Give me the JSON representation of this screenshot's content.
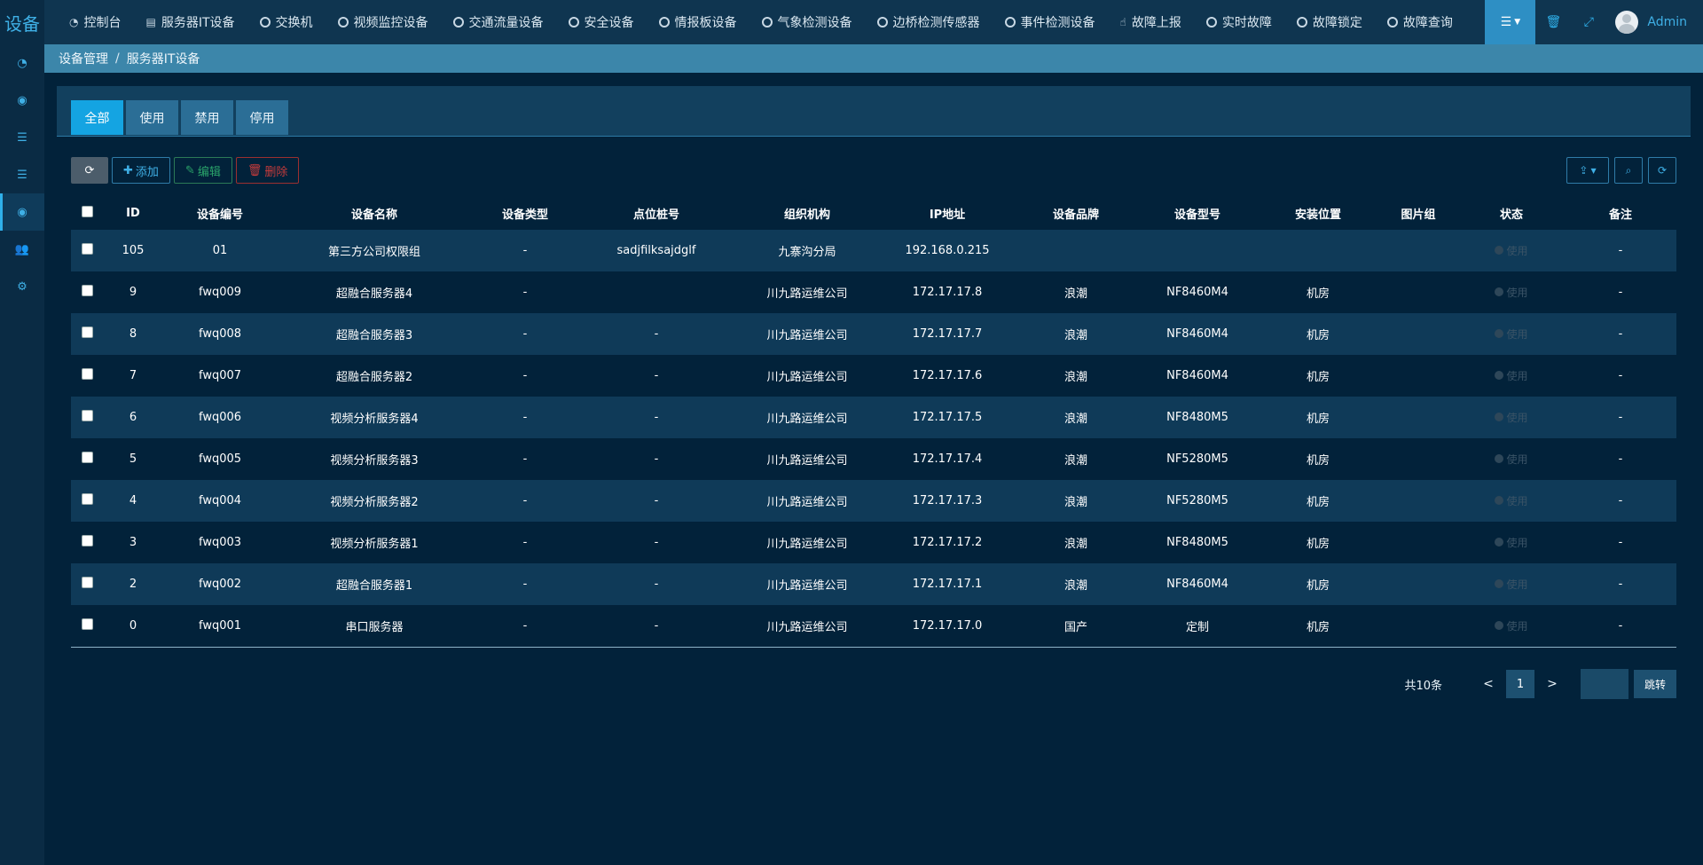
{
  "brand": "设备",
  "nav": [
    {
      "label": "控制台",
      "icon": "dashboard-icon"
    },
    {
      "label": "服务器IT设备",
      "icon": "server-icon"
    },
    {
      "label": "交换机",
      "icon": "circle-icon"
    },
    {
      "label": "视频监控设备",
      "icon": "circle-icon"
    },
    {
      "label": "交通流量设备",
      "icon": "circle-icon"
    },
    {
      "label": "安全设备",
      "icon": "circle-icon"
    },
    {
      "label": "情报板设备",
      "icon": "circle-icon"
    },
    {
      "label": "气象检测设备",
      "icon": "circle-icon"
    },
    {
      "label": "边桥检测传感器",
      "icon": "circle-icon"
    },
    {
      "label": "事件检测设备",
      "icon": "circle-icon"
    },
    {
      "label": "故障上报",
      "icon": "hand-icon"
    },
    {
      "label": "实时故障",
      "icon": "circle-icon"
    },
    {
      "label": "故障锁定",
      "icon": "circle-icon"
    },
    {
      "label": "故障查询",
      "icon": "circle-icon"
    }
  ],
  "user": {
    "name": "Admin"
  },
  "breadcrumb": {
    "parent": "设备管理",
    "current": "服务器IT设备"
  },
  "tabs": [
    "全部",
    "使用",
    "禁用",
    "停用"
  ],
  "toolbar": {
    "add": "添加",
    "edit": "编辑",
    "delete": "删除"
  },
  "table": {
    "headers": [
      "ID",
      "设备编号",
      "设备名称",
      "设备类型",
      "点位桩号",
      "组织机构",
      "IP地址",
      "设备品牌",
      "设备型号",
      "安装位置",
      "图片组",
      "状态",
      "备注"
    ],
    "rows": [
      [
        "105",
        "01",
        "第三方公司权限组",
        "-",
        "sadjfilksajdglf",
        "九寨沟分局",
        "192.168.0.215",
        "",
        "",
        "",
        "",
        "使用",
        "-"
      ],
      [
        "9",
        "fwq009",
        "超融合服务器4",
        "-",
        "",
        "川九路运维公司",
        "172.17.17.8",
        "浪潮",
        "NF8460M4",
        "机房",
        "",
        "使用",
        "-"
      ],
      [
        "8",
        "fwq008",
        "超融合服务器3",
        "-",
        "-",
        "川九路运维公司",
        "172.17.17.7",
        "浪潮",
        "NF8460M4",
        "机房",
        "",
        "使用",
        "-"
      ],
      [
        "7",
        "fwq007",
        "超融合服务器2",
        "-",
        "-",
        "川九路运维公司",
        "172.17.17.6",
        "浪潮",
        "NF8460M4",
        "机房",
        "",
        "使用",
        "-"
      ],
      [
        "6",
        "fwq006",
        "视频分析服务器4",
        "-",
        "-",
        "川九路运维公司",
        "172.17.17.5",
        "浪潮",
        "NF8480M5",
        "机房",
        "",
        "使用",
        "-"
      ],
      [
        "5",
        "fwq005",
        "视频分析服务器3",
        "-",
        "-",
        "川九路运维公司",
        "172.17.17.4",
        "浪潮",
        "NF5280M5",
        "机房",
        "",
        "使用",
        "-"
      ],
      [
        "4",
        "fwq004",
        "视频分析服务器2",
        "-",
        "-",
        "川九路运维公司",
        "172.17.17.3",
        "浪潮",
        "NF5280M5",
        "机房",
        "",
        "使用",
        "-"
      ],
      [
        "3",
        "fwq003",
        "视频分析服务器1",
        "-",
        "-",
        "川九路运维公司",
        "172.17.17.2",
        "浪潮",
        "NF8480M5",
        "机房",
        "",
        "使用",
        "-"
      ],
      [
        "2",
        "fwq002",
        "超融合服务器1",
        "-",
        "-",
        "川九路运维公司",
        "172.17.17.1",
        "浪潮",
        "NF8460M4",
        "机房",
        "",
        "使用",
        "-"
      ],
      [
        "0",
        "fwq001",
        "串口服务器",
        "-",
        "-",
        "川九路运维公司",
        "172.17.17.0",
        "国产",
        "定制",
        "机房",
        "",
        "使用",
        "-"
      ]
    ]
  },
  "pagination": {
    "total": "共10条",
    "prev": "<",
    "current": "1",
    "next": ">",
    "go": "跳转"
  },
  "colors": {
    "accent": "#14a4e2",
    "topbar": "#0f3550",
    "breadcrumb": "#3c86aa",
    "background": "#02223a"
  }
}
